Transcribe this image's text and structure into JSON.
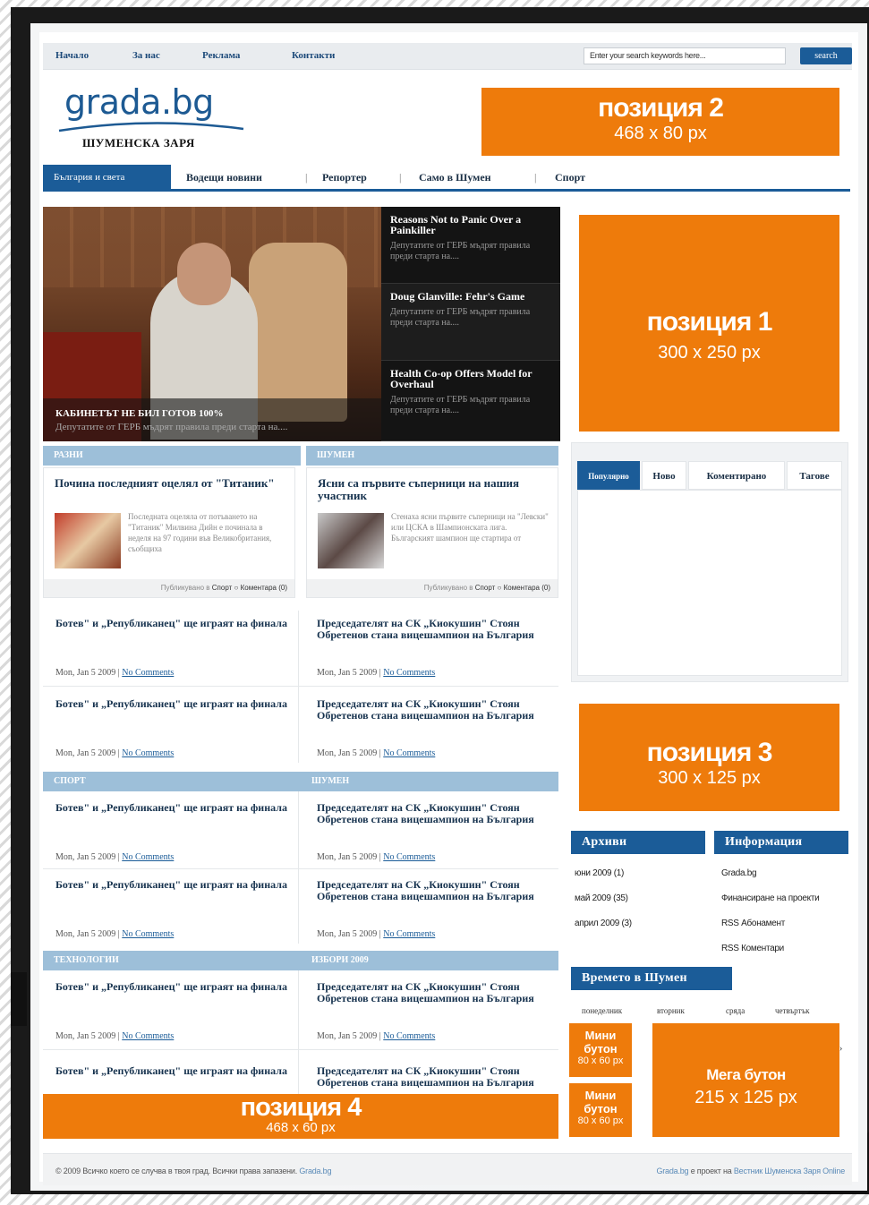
{
  "top_nav": [
    "Начало",
    "За нас",
    "Реклама",
    "Контакти"
  ],
  "search": {
    "placeholder": "Enter your search keywords here...",
    "button": "search"
  },
  "logo": {
    "main": "grada.bg",
    "sub": "ШУМЕНСКА ЗАРЯ"
  },
  "ads": {
    "pos2": {
      "title": "позиция 2",
      "size": "468 x 80 px"
    },
    "pos1": {
      "title": "позиция 1",
      "size": "300 x 250 px"
    },
    "pos3": {
      "title": "позиция 3",
      "size": "300 x 125 px"
    },
    "pos4": {
      "title": "позиция 4",
      "size": "468 x 60 px"
    },
    "mini1": {
      "title": "Мини бутон",
      "size": "80 x 60 px"
    },
    "mini2": {
      "title": "Мини бутон",
      "size": "80 x 60 px"
    },
    "mega": {
      "title": "Мега бутон",
      "size": "215 x 125 px"
    }
  },
  "main_nav": {
    "active": "България и света",
    "items": [
      "Водещи новини",
      "Репортер",
      "Само в Шумен",
      "Спорт"
    ]
  },
  "featured": {
    "title": "КАБИНЕТЪТ НЕ БИЛ ГОТОВ 100%",
    "subtitle": "Депутатите от ГЕРБ мъдрят правила преди старта на....",
    "side": [
      {
        "title": "Reasons Not to Panic Over a Painkiller",
        "desc": "Депутатите от ГЕРБ мъдрят правила преди старта на...."
      },
      {
        "title": "Doug Glanville: Fehr's Game",
        "desc": "Депутатите от ГЕРБ мъдрят правила преди старта на...."
      },
      {
        "title": "Health Co-op Offers Model for Overhaul",
        "desc": "Депутатите от ГЕРБ мъдрят правила преди старта на...."
      }
    ]
  },
  "sections": [
    {
      "left": "РАЗНИ",
      "right": "ШУМЕН"
    },
    {
      "left": "СПОРТ",
      "right": "ШУМЕН"
    },
    {
      "left": "ТЕХНОЛОГИИ",
      "right": "ИЗБОРИ 2009"
    }
  ],
  "cards": [
    {
      "title": "Почина последният оцелял от \"Титаник\"",
      "text": "Последната оцеляла от потъването на \"Титаник\" Милвина Дийн е починала в неделя на 97 години във Великобритания, съобщиха",
      "meta_prefix": "Публикувано в",
      "category": "Спорт",
      "comments": "Коментара (0)"
    },
    {
      "title": "Ясни са първите съперници на нашия участник",
      "text": "Стенаха ясни първите съперници на \"Левски\" или ЦСКА в Шампионската лига. Българският шампион ще стартира от",
      "meta_prefix": "Публикувано в",
      "category": "Спорт",
      "comments": "Коментара (0)"
    }
  ],
  "news_left": "Ботев\" и „Републиканец\" ще играят на финала",
  "news_right": "Председателят на СК „Киокушин\" Стоян Обретенов стана вицешампион на България",
  "news_date": "Mon, Jan 5 2009",
  "news_comments": "No Comments",
  "tabs": [
    "Популярно",
    "Ново",
    "Коментирано",
    "Тагове"
  ],
  "archives": {
    "title": "Архиви",
    "items": [
      "юни 2009 (1)",
      "май 2009 (35)",
      "април 2009 (3)"
    ]
  },
  "info": {
    "title": "Информация",
    "items": [
      "Grada.bg",
      "Финансиране на проекти",
      "RSS Абонамент",
      "RSS Коментари"
    ]
  },
  "weather": {
    "title": "Времето в Шумен",
    "days": [
      "понеделник",
      "вторник",
      "сряда",
      "четвъртък"
    ]
  },
  "footer": {
    "left": "© 2009 Всичко което се случва в твоя град. Всички права запазени.",
    "left_link": "Grada.bg",
    "right_link1": "Grada.bg",
    "right_mid": "е проект на",
    "right_link2": "Вестник Шуменска Заря Online"
  }
}
